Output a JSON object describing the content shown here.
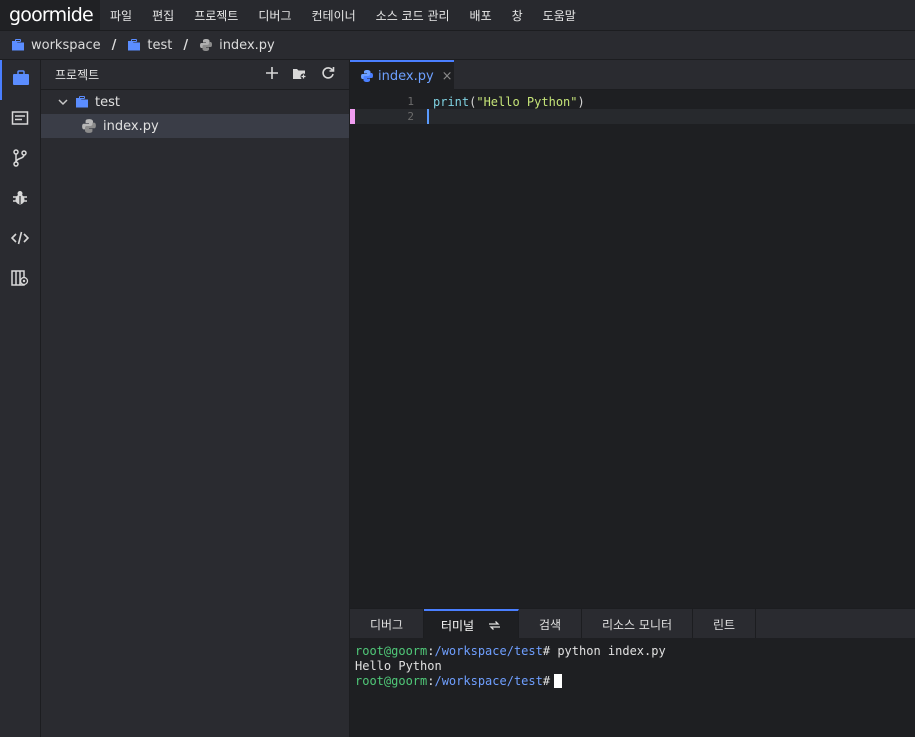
{
  "app": {
    "logo": "goormide"
  },
  "menu": [
    "파일",
    "편집",
    "프로젝트",
    "디버그",
    "컨테이너",
    "소스 코드 관리",
    "배포",
    "창",
    "도움말"
  ],
  "breadcrumb": {
    "items": [
      "workspace",
      "test",
      "index.py"
    ],
    "separator": "/"
  },
  "activity_bar": {
    "icons": [
      "project-icon",
      "editor-icon",
      "git-icon",
      "debug-icon",
      "code-icon",
      "extension-icon"
    ]
  },
  "project_panel": {
    "title": "프로젝트",
    "actions": [
      "add-icon",
      "new-folder-icon",
      "refresh-icon"
    ],
    "folder": "test",
    "file": "index.py"
  },
  "editor": {
    "tab": {
      "label": "index.py",
      "close": "×"
    },
    "lines": [
      {
        "num": "1",
        "fn": "print",
        "open": "(",
        "str": "\"Hello Python\"",
        "close": ")"
      },
      {
        "num": "2"
      }
    ]
  },
  "bottom_panel": {
    "tabs": [
      "디버그",
      "터미널",
      "검색",
      "리소스 모니터",
      "린트"
    ],
    "active_tab": "터미널"
  },
  "terminal": {
    "user": "root@goorm",
    "colon": ":",
    "path": "/workspace/test",
    "prompt": "#",
    "command": " python index.py",
    "output": "Hello Python"
  },
  "colors": {
    "accent": "#4a7fff",
    "string": "#c5e478",
    "keyword": "#7fd1e0",
    "terminal_user": "#50c878",
    "terminal_path": "#6f9fff"
  }
}
